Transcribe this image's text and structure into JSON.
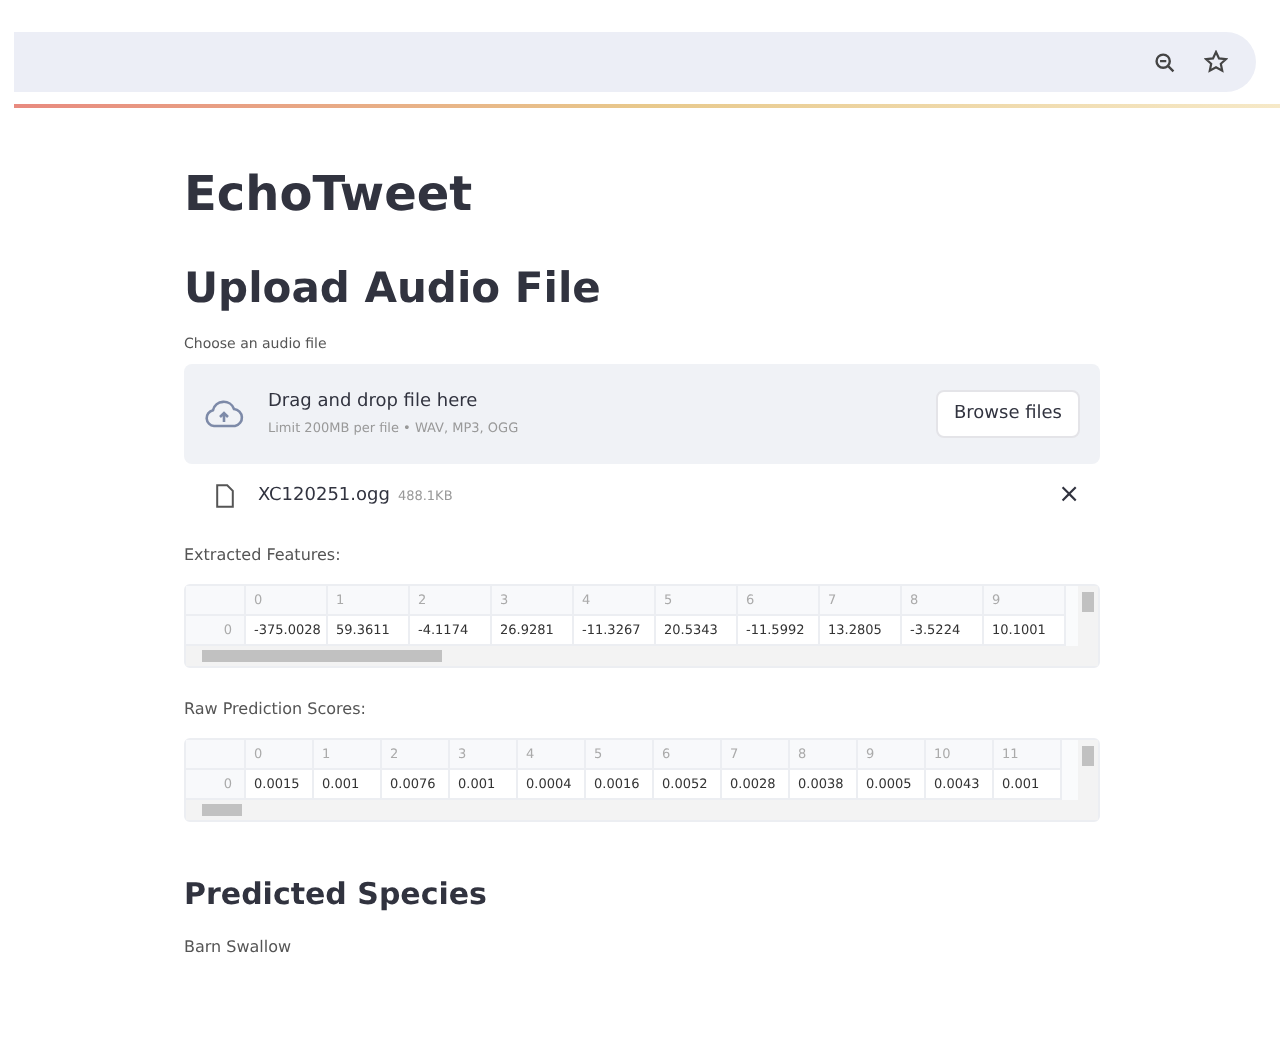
{
  "title": "EchoTweet",
  "upload": {
    "heading": "Upload Audio File",
    "label": "Choose an audio file",
    "drop_text": "Drag and drop file here",
    "limit_text": "Limit 200MB per file • WAV, MP3, OGG",
    "browse_button": "Browse files",
    "file": {
      "name": "XC120251.ogg",
      "size": "488.1KB",
      "remove": "×"
    }
  },
  "tables": [
    {
      "label": "Extracted Features:",
      "columns": [
        "0",
        "1",
        "2",
        "3",
        "4",
        "5",
        "6",
        "7",
        "8",
        "9"
      ],
      "index": "0",
      "values": [
        "-375.0028",
        "59.3611",
        "-4.1174",
        "26.9281",
        "-11.3267",
        "20.5343",
        "-11.5992",
        "13.2805",
        "-3.5224",
        "10.1001"
      ]
    },
    {
      "label": "Raw Prediction Scores:",
      "columns": [
        "0",
        "1",
        "2",
        "3",
        "4",
        "5",
        "6",
        "7",
        "8",
        "9",
        "10",
        "11"
      ],
      "index": "0",
      "values": [
        "0.0015",
        "0.001",
        "0.0076",
        "0.001",
        "0.0004",
        "0.0016",
        "0.0052",
        "0.0028",
        "0.0038",
        "0.0005",
        "0.0043",
        "0.001"
      ]
    }
  ],
  "result": {
    "heading": "Predicted Species",
    "species": "Barn Swallow"
  }
}
